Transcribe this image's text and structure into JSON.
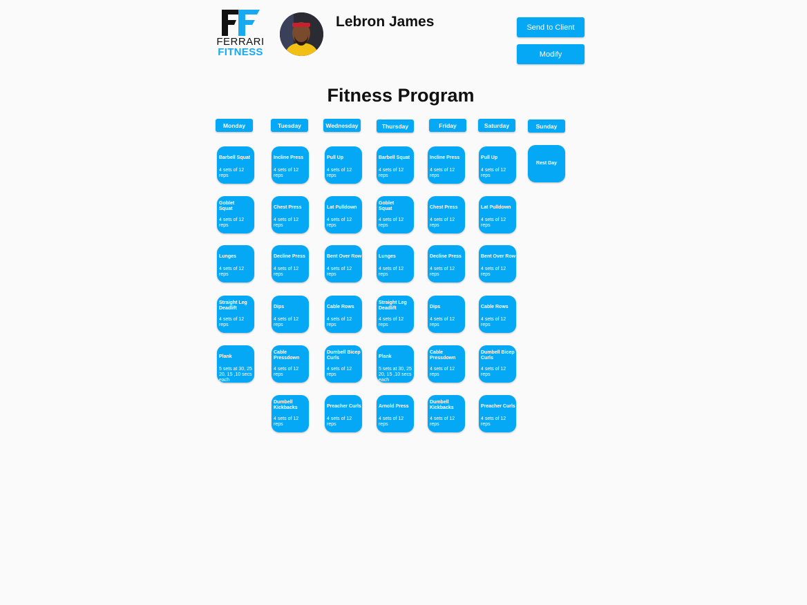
{
  "header": {
    "logo": {
      "mark": "FF",
      "line1": "FERRARI",
      "line2": "FITNESS",
      "icon": "ferrari-fitness-logo"
    },
    "client_name": "Lebron James",
    "send_label": "Send to Client",
    "modify_label": "Modify",
    "accent": "#05a8f4"
  },
  "page_title": "Fitness Program",
  "days": [
    {
      "label": "Monday",
      "exercises": [
        {
          "name": "Barbell Squat",
          "sets": "4 sets of 12\nreps"
        },
        {
          "name": "Goblet\nSquat",
          "sets": "4 sets of 12\nreps"
        },
        {
          "name": "Lunges",
          "sets": "4 sets of 12\nreps"
        },
        {
          "name": "Straight Leg\nDeadlift",
          "sets": "4 sets of 12\nreps"
        },
        {
          "name": "Plank",
          "sets": "5 sets at 30, 25\n20, 15 ,10 secs\neach"
        }
      ]
    },
    {
      "label": "Tuesday",
      "exercises": [
        {
          "name": "Incline Press",
          "sets": "4 sets of 12\nreps"
        },
        {
          "name": "Chest Press",
          "sets": "4 sets of 12\nreps"
        },
        {
          "name": "Decline Press",
          "sets": "4 sets of 12\nreps"
        },
        {
          "name": "Dips",
          "sets": "4 sets of 12\nreps"
        },
        {
          "name": "Cable\nPressdown",
          "sets": "4 sets of 12\nreps"
        },
        {
          "name": "Dumbell\nKickbacks",
          "sets": "4 sets of 12\nreps"
        }
      ]
    },
    {
      "label": "Wednesday",
      "exercises": [
        {
          "name": "Pull Up",
          "sets": "4 sets of 12\nreps"
        },
        {
          "name": "Lat Pulldown",
          "sets": "4 sets of 12\nreps"
        },
        {
          "name": "Bent Over Row",
          "sets": "4 sets of 12\nreps"
        },
        {
          "name": "Cable Rows",
          "sets": "4 sets of 12\nreps"
        },
        {
          "name": "Dumbell Bicep\nCurls",
          "sets": "4 sets of 12\nreps"
        },
        {
          "name": "Preacher Curls",
          "sets": "4 sets of 12\nreps"
        }
      ]
    },
    {
      "label": "Thursday",
      "exercises": [
        {
          "name": "Barbell Squat",
          "sets": "4 sets of 12\nreps"
        },
        {
          "name": "Goblet\nSquat",
          "sets": "4 sets of 12\nreps"
        },
        {
          "name": "Lunges",
          "sets": "4 sets of 12\nreps"
        },
        {
          "name": "Straight Leg\nDeadlift",
          "sets": "4 sets of 12\nreps"
        },
        {
          "name": "Plank",
          "sets": "5 sets at 30, 25\n20, 15 ,10 secs\neach"
        },
        {
          "name": "Arnold Press",
          "sets": "4 sets of 12\nreps"
        }
      ]
    },
    {
      "label": "Friday",
      "exercises": [
        {
          "name": "Incline Press",
          "sets": "4 sets of 12\nreps"
        },
        {
          "name": "Chest Press",
          "sets": "4 sets of 12\nreps"
        },
        {
          "name": "Decline Press",
          "sets": "4 sets of 12\nreps"
        },
        {
          "name": "Dips",
          "sets": "4 sets of 12\nreps"
        },
        {
          "name": "Cable\nPressdown",
          "sets": "4 sets of 12\nreps"
        },
        {
          "name": "Dumbell\nKickbacks",
          "sets": "4 sets of 12\nreps"
        }
      ]
    },
    {
      "label": "Saturday",
      "exercises": [
        {
          "name": "Pull Up",
          "sets": "4 sets of 12\nreps"
        },
        {
          "name": "Lat Pulldown",
          "sets": "4 sets of 12\nreps"
        },
        {
          "name": "Bent Over Row",
          "sets": "4 sets of 12\nreps"
        },
        {
          "name": "Cable Rows",
          "sets": "4 sets of 12\nreps"
        },
        {
          "name": "Dumbell Bicep\nCurls",
          "sets": "4 sets of 12\nreps"
        },
        {
          "name": "Preacher Curls",
          "sets": "4 sets of 12\nreps"
        }
      ]
    },
    {
      "label": "Sunday",
      "exercises": [
        {
          "name": "Rest Day",
          "sets": ""
        }
      ]
    }
  ]
}
